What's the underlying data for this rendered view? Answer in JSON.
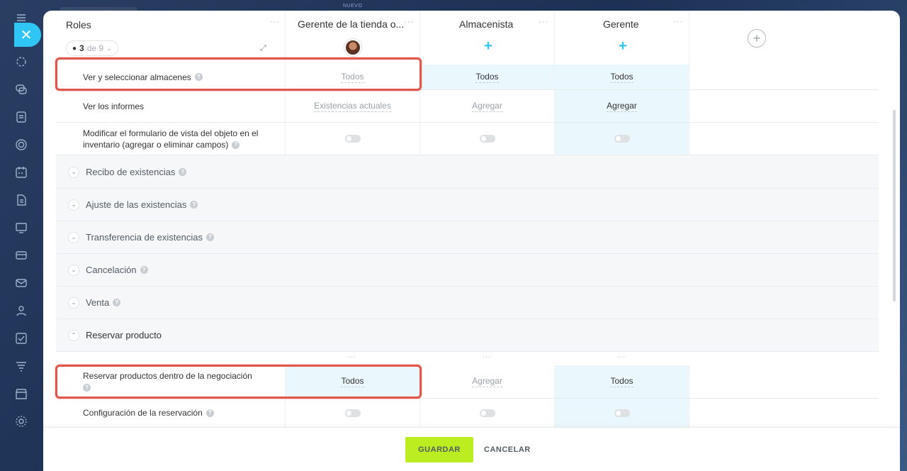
{
  "background": {
    "top_label": "NUEVO"
  },
  "close_button": {
    "symbol": "✕"
  },
  "header": {
    "roles_title": "Roles",
    "counter_selected": "3",
    "counter_rest": "de 9",
    "columns": [
      {
        "title": "Gerente de la tienda o..."
      },
      {
        "title": "Almacenista"
      },
      {
        "title": "Gerente"
      }
    ],
    "add_symbol": "+",
    "dots": "···"
  },
  "rows": [
    {
      "label": "Ver y seleccionar almacenes",
      "values": [
        "Todos",
        "Todos",
        "Todos"
      ]
    },
    {
      "label": "Ver los informes",
      "values": [
        "Existencias actuales",
        "Agregar",
        "Agregar"
      ]
    },
    {
      "label": "Modificar el formulario de vista del objeto en el inventario (agregar o eliminar campos)"
    }
  ],
  "sections": [
    {
      "label": "Recibo de existencias"
    },
    {
      "label": "Ajuste de las existencias"
    },
    {
      "label": "Transferencia de existencias"
    },
    {
      "label": "Cancelación"
    },
    {
      "label": "Venta"
    },
    {
      "label": "Reservar producto"
    }
  ],
  "reserve_rows": [
    {
      "label": "Reservar productos dentro de la negociación",
      "values": [
        "Todos",
        "Agregar",
        "Todos"
      ]
    },
    {
      "label": "Configuración de la reservación"
    }
  ],
  "help_symbol": "?",
  "footer": {
    "save_label": "GUARDAR",
    "cancel_label": "CANCELAR"
  }
}
